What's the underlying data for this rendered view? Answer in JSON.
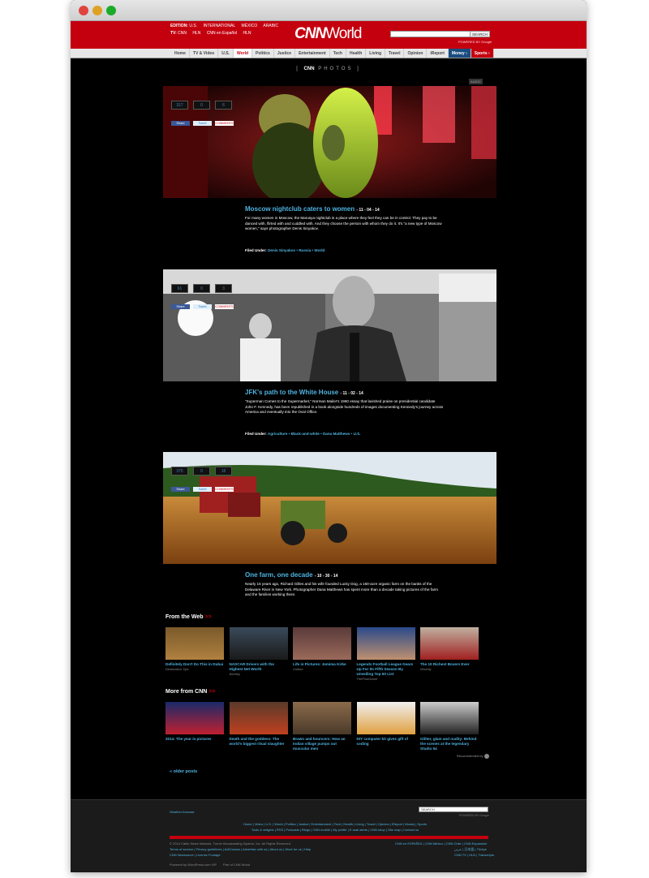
{
  "header": {
    "edition_label": "EDITION:",
    "editions": [
      "U.S.",
      "INTERNATIONAL",
      "MÉXICO",
      "ARABIC"
    ],
    "tv_label": "TV:",
    "tv": [
      "CNN",
      "HLN",
      "CNN en Español",
      "HLN"
    ],
    "logo_cnn": "CNN",
    "logo_world": "World",
    "search_button": "SEARCH",
    "powered_by": "POWERED BY Google"
  },
  "nav": [
    "Home",
    "TV & Video",
    "U.S.",
    "World",
    "Politics",
    "Justice",
    "Entertainment",
    "Tech",
    "Health",
    "Living",
    "Travel",
    "Opinion",
    "iReport",
    "Money ›",
    "Sports ›"
  ],
  "photos_title": {
    "cnn": "CNN",
    "photos": "PHOTOS"
  },
  "audio": "AUDIO",
  "posts": [
    {
      "count": "317",
      "tw": "0",
      "cm": "6",
      "title": "Moscow nightclub caters to women",
      "date": "- 11 - 04 - 14",
      "desc": "For many women in Moscow, the Marusya nightclub is a place where they feel they can be in control. They pay to be danced with, flirted with and cuddled with. And they choose the person with whom they do it. It's \"a new type of Moscow women,\" says photographer Denis Sinyakov.",
      "filed_label": "Filed Under:",
      "filed": "Denis Sinyakov • Russia • World"
    },
    {
      "count": "61",
      "tw": "0",
      "cm": "3",
      "title": "JFK's path to the White House",
      "date": "- 11 - 02 - 14",
      "desc": "\"Superman Comes to the Supermarket,\" Norman Mailer's 1960 essay that lavished praise on presidential candidate John F. Kennedy, has been republished in a book alongside hundreds of images documenting Kennedy's journey across America and eventually into the Oval Office.",
      "filed_label": "Filed Under:",
      "filed": "Agriculture • Black-and-white • Dana Matthews • U.S."
    },
    {
      "count": "375",
      "tw": "0",
      "cm": "16",
      "title": "One farm, one decade",
      "date": "- 10 - 30 - 14",
      "desc": "Nearly 15 years ago, Richard Gilles and his wife founded Lucky Dog, a 160-acre organic farm on the banks of the Delaware River in New York. Photographer Dana Matthews has spent more than a decade taking pictures of the farm and the families working there."
    }
  ],
  "share": {
    "fb": "Share",
    "tw": "Tweet",
    "cm": "COMMENTS"
  },
  "from_web": {
    "title": "From the Web",
    "arrow": ">>",
    "items": [
      {
        "cap": "Definitely Don't Do This in Dubai",
        "src": "Destination Tips"
      },
      {
        "cap": "NASCAR Drivers with the Highest Net Worth",
        "src": "Worthly"
      },
      {
        "cap": "Life in Pictures: Jemima Kirke",
        "src": "Vulture"
      },
      {
        "cap": "Legends Football League Gears Up For Its Fifth Season By Unveiling Top 50 List",
        "src": "ThePostGame"
      },
      {
        "cap": "The 10 Richest Boxers Ever",
        "src": "Worthly"
      }
    ]
  },
  "more_cnn": {
    "title": "More from CNN",
    "arrow": ">>",
    "items": [
      {
        "cap": "2014: The year in pictures"
      },
      {
        "cap": "Death and the goddess: The world's biggest ritual slaughter"
      },
      {
        "cap": "Brawn and bouncers: How an Indian village pumps out muscular men"
      },
      {
        "cap": "DIY computer kit gives gift of coding"
      },
      {
        "cap": "Glitter, glam and nudity: Behind the scenes at the legendary Studio 54"
      }
    ]
  },
  "recommended": "Recommended by",
  "older_posts": "« older posts",
  "footer": {
    "weather": "Weather forecast",
    "search_placeholder": "SEARCH",
    "powered_by": "POWERED BY Google",
    "links1": "Home | Video | U.S. | World | Politics | Justice | Entertainment | Tech | Health | Living | Travel | Opinion | iReport | Money | Sports",
    "links2": "Tools & widgets | RSS | Podcasts | Blogs | CNN mobile | My profile | E-mail alerts | CNN shop | Site map | Contact us",
    "copyright": "© 2014 Cable News Network. Turner Broadcasting System, Inc. All Rights Reserved.",
    "terms": "Terms of service | Privacy guidelines | AdChoices | Advertise with us | About us | Work for us | Help",
    "newsource": "CNN Newsource | License Footage",
    "right1": "CNN en ESPAÑOL | CNN México | CNN Chile | CNN Expansión",
    "right2": "عربي | 日本語 | Türkçe",
    "right3": "CNN TV | HLN | Transcripts",
    "powered": "Powered by WordPress.com VIP",
    "partof": "Part of CNN World"
  }
}
